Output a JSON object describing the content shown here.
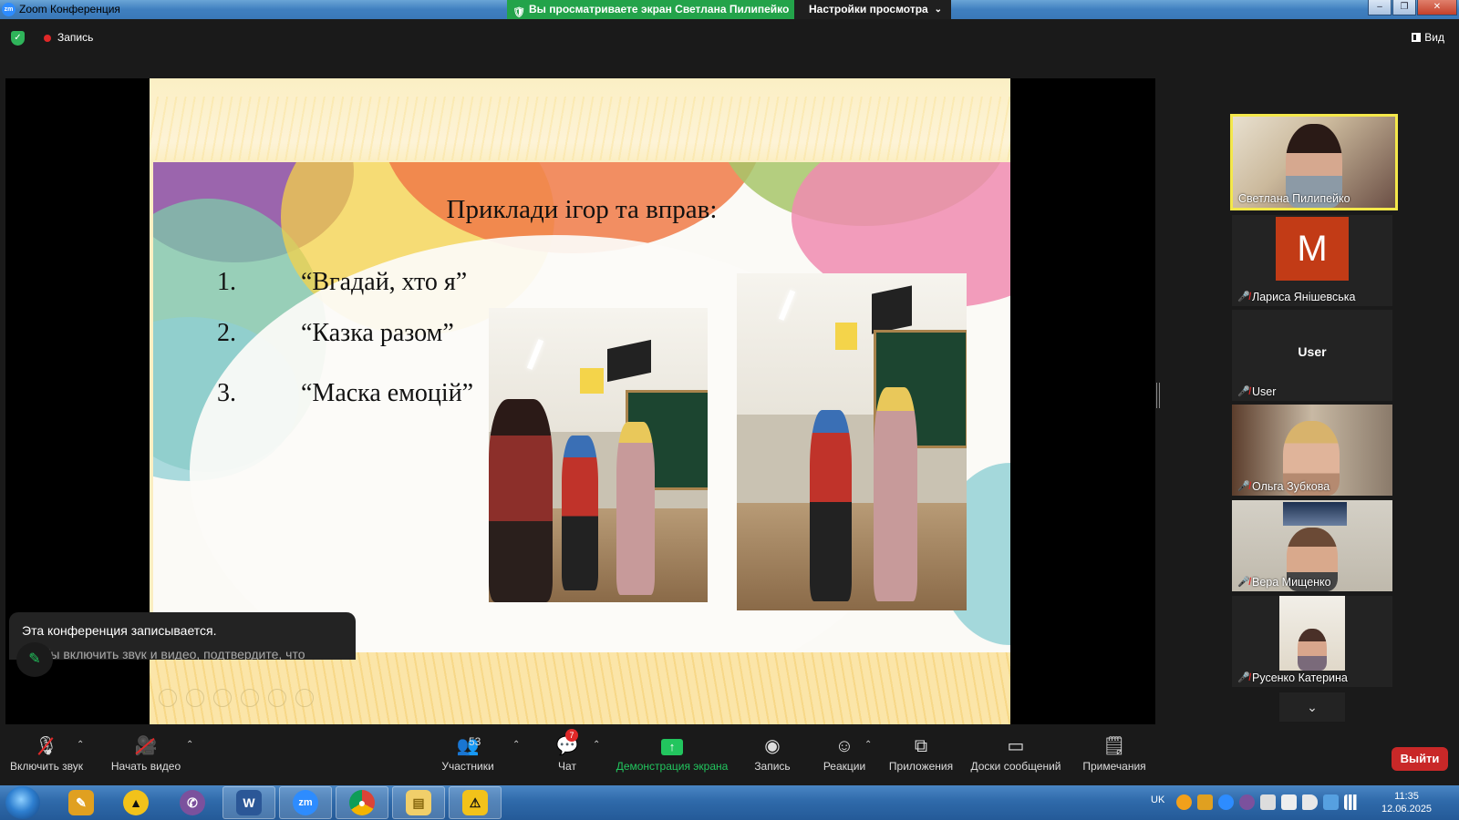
{
  "window": {
    "title": "Zoom Конференция",
    "app_icon": "zm",
    "share_banner": "Вы просматриваете экран Светлана Пилипейко",
    "view_options": "Настройки просмотра",
    "controls": [
      "–",
      "❐",
      "✕"
    ]
  },
  "meeting_header": {
    "recording_label": "Запись",
    "view_label": "Вид"
  },
  "slide": {
    "title": "Приклади ігор та вправ:",
    "items": [
      {
        "num": "1.",
        "text": "“Вгадай, хто я”"
      },
      {
        "num": "2.",
        "text": "“Казка разом”"
      },
      {
        "num": "3.",
        "text": "“Маска емоцій”"
      }
    ]
  },
  "toast": {
    "title": "Эта конференция записывается.",
    "body": "Чтобы включить звук и видео, подтвердите, что"
  },
  "participants_gallery": [
    {
      "name": "Светлана Пилипейко",
      "muted": false,
      "active_speaker": true,
      "video": true
    },
    {
      "name": "Лариса Янішевська",
      "muted": true,
      "avatar_letter": "M",
      "avatar_color": "#c23b16"
    },
    {
      "name": "User",
      "muted": true,
      "display_center": "User"
    },
    {
      "name": "Ольга Зубкова",
      "muted": true,
      "video": true
    },
    {
      "name": "Вера Мищенко",
      "muted": true,
      "video": true
    },
    {
      "name": "Русенко Катерина",
      "muted": true,
      "video": true
    }
  ],
  "toolbar": {
    "mute_label": "Включить звук",
    "video_label": "Начать видео",
    "participants_label": "Участники",
    "participants_count": "53",
    "chat_label": "Чат",
    "chat_badge": "7",
    "share_label": "Демонстрация экрана",
    "record_label": "Запись",
    "reactions_label": "Реакции",
    "apps_label": "Приложения",
    "whiteboards_label": "Доски сообщений",
    "notes_label": "Примечания",
    "leave_label": "Выйти"
  },
  "taskbar": {
    "language": "UK",
    "time": "11:35",
    "date": "12.06.2025",
    "apps": [
      "start",
      "paint",
      "archicad",
      "viber",
      "word",
      "zoom",
      "chrome",
      "explorer",
      "warning"
    ]
  },
  "colors": {
    "share_banner_green": "#23a34a",
    "leave_red": "#c92828",
    "active_speaker_border": "#f4e84a",
    "share_screen_green": "#22c55e"
  }
}
